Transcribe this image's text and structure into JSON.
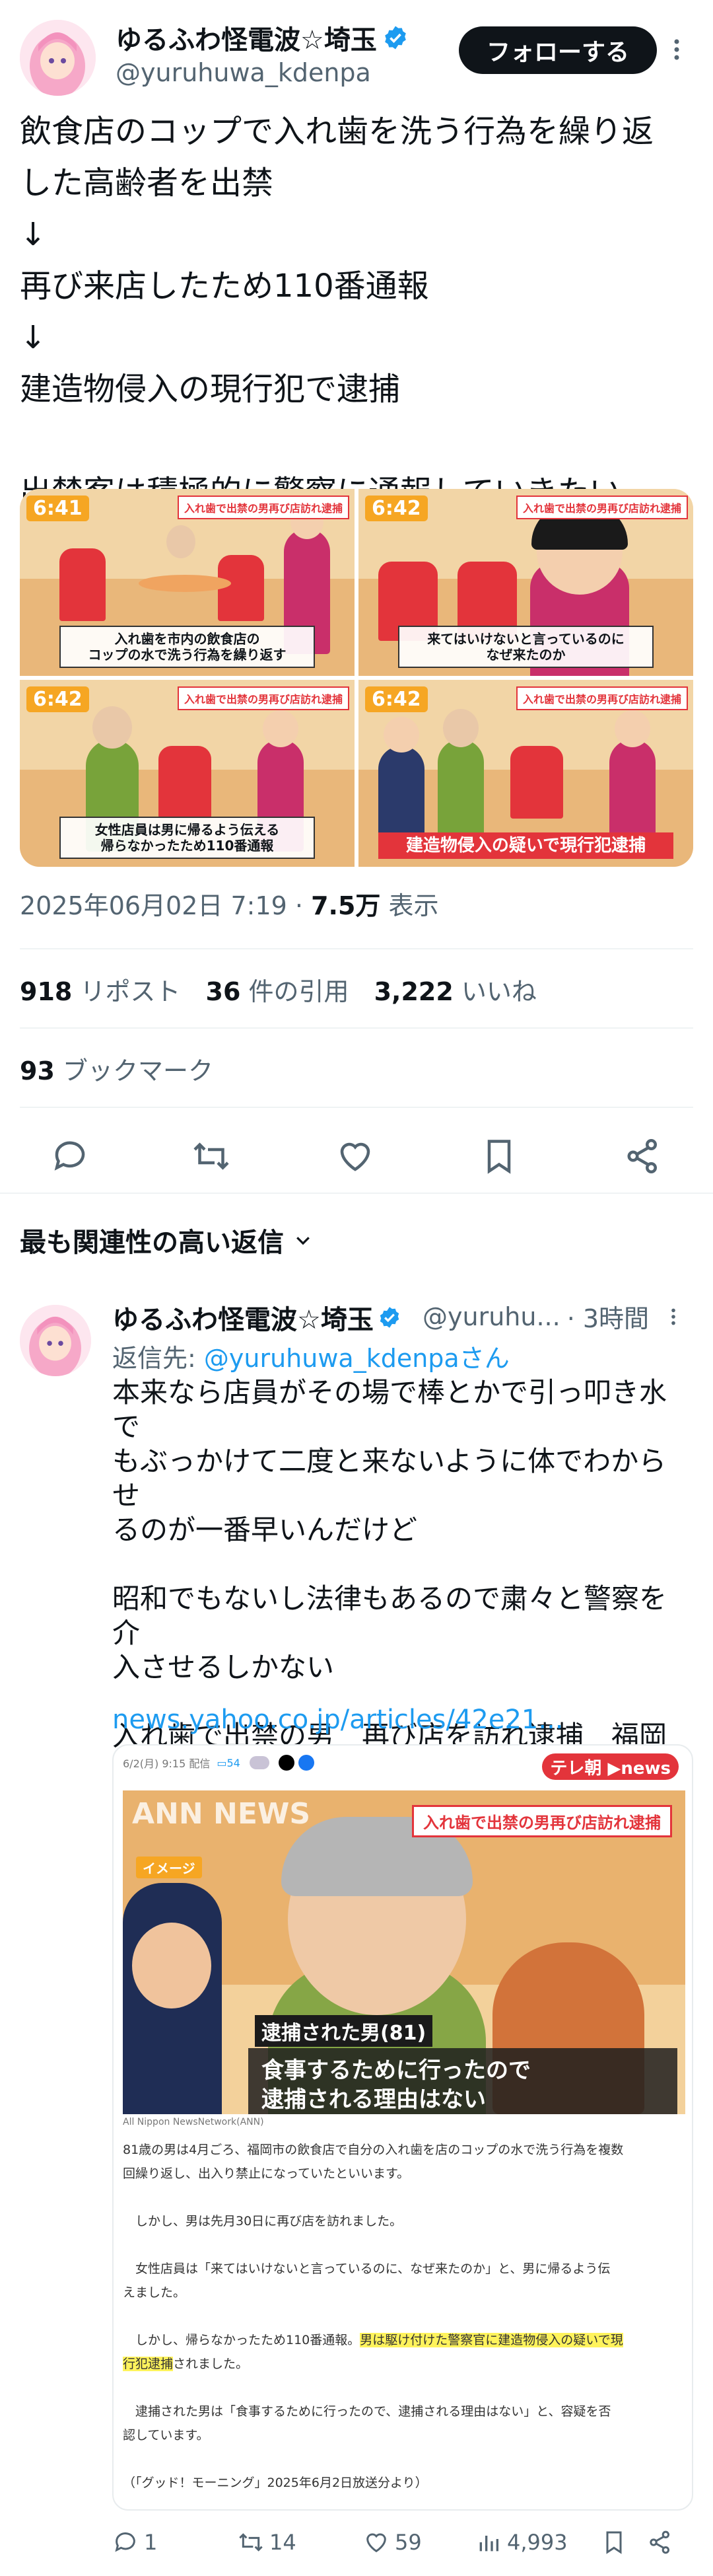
{
  "post": {
    "author_name": "ゆるふわ怪電波☆埼玉",
    "author_handle": "@yuruhuwa_kdenpa",
    "follow_label": "フォローする",
    "text": "飲食店のコップで入れ歯を洗う行為を繰り返\nした高齢者を出禁\n↓\n再び来店したため110番通報\n↓\n建造物侵入の現行犯で逮捕\n\n出禁客は積極的に警察に通報していきたい",
    "date": "2025年06月02日 7:19",
    "sep": " · ",
    "views_count": "7.5万",
    "views_label": " 表示",
    "reposts_count": "918",
    "reposts_label": " リポスト",
    "quotes_count": "36",
    "quotes_label": " 件の引用",
    "likes_count": "3,222",
    "likes_label": " いいね",
    "bookmarks_count": "93",
    "bookmarks_label": " ブックマーク"
  },
  "media": {
    "panels": [
      {
        "time": "6:41",
        "top_caption": "入れ歯で出禁の男再び店訪れ逮捕",
        "caption": "入れ歯を市内の飲食店の\nコップの水で洗う行為を繰り返す"
      },
      {
        "time": "6:42",
        "top_caption": "入れ歯で出禁の男再び店訪れ逮捕",
        "caption": "来てはいけないと言っているのに\nなぜ来たのか"
      },
      {
        "time": "6:42",
        "top_caption": "入れ歯で出禁の男再び店訪れ逮捕",
        "caption": "女性店員は男に帰るよう伝える\n帰らなかったため110番通報"
      },
      {
        "time": "6:42",
        "top_caption": "入れ歯で出禁の男再び店訪れ逮捕",
        "caption": "建造物侵入の疑いで現行犯逮捕"
      }
    ]
  },
  "sort_label": "最も関連性の高い返信",
  "reply": {
    "author_name": "ゆるふわ怪電波☆埼玉",
    "author_handle": "@yuruhu...",
    "time": "· 3時間",
    "reply_to_prefix": "返信先: ",
    "reply_to_handle": "@yuruhuwa_kdenpaさん",
    "text": "本来なら店員がその場で棒とかで引っ叩き水で\nもぶっかけて二度と来ないように体でわからせ\nるのが一番早いんだけど\n\n昭和でもないし法律もあるので粛々と警察を介\n入させるしかない\n\n入れ歯で出禁の男　再び店を訪れ逮捕　福岡市\n(テレビ朝日系（ANN）)",
    "link": "news.yahoo.co.jp/articles/42e21...",
    "card": {
      "meta": "6/2(月) 9:15 配信",
      "comments": "54",
      "brand": "テレ朝 ▶news",
      "image_title": "入れ歯で出禁の男再び店訪れ逮捕",
      "image_tag": "イメージ",
      "ann": "ANN NEWS",
      "caption_small": "逮捕された男(81)",
      "caption_big": "食事するために行ったので\n逮捕される理由はない",
      "network": "All Nippon NewsNetwork(ANN)",
      "para1": "81歳の男は4月ごろ、福岡市の飲食店で自分の入れ歯を店のコップの水で洗う行為を複数\n回繰り返し、出入り禁止になっていたといいます。",
      "para2": "　しかし、男は先月30日に再び店を訪れました。",
      "para3": "　女性店員は「来てはいけないと言っているのに、なぜ来たのか」と、男に帰るよう伝\nえました。",
      "para4a": "　しかし、帰らなかったため110番通報。",
      "para4b": "男は駆け付けた警察官に建造物侵入の疑いで現\n行犯逮捕",
      "para4c": "されました。",
      "para5": "　逮捕された男は「食事するために行ったので、逮捕される理由はない」と、容疑を否\n認しています。",
      "para6": "（「グッド！モーニング」2025年6月2日放送分より）"
    },
    "replies_count": "1",
    "reposts_count": "14",
    "likes_count": "59",
    "views_count": "4,993"
  },
  "colors": {
    "accent": "#1d9bf0",
    "text": "#0f1419",
    "muted": "#536471",
    "news_red": "#e3343b"
  }
}
